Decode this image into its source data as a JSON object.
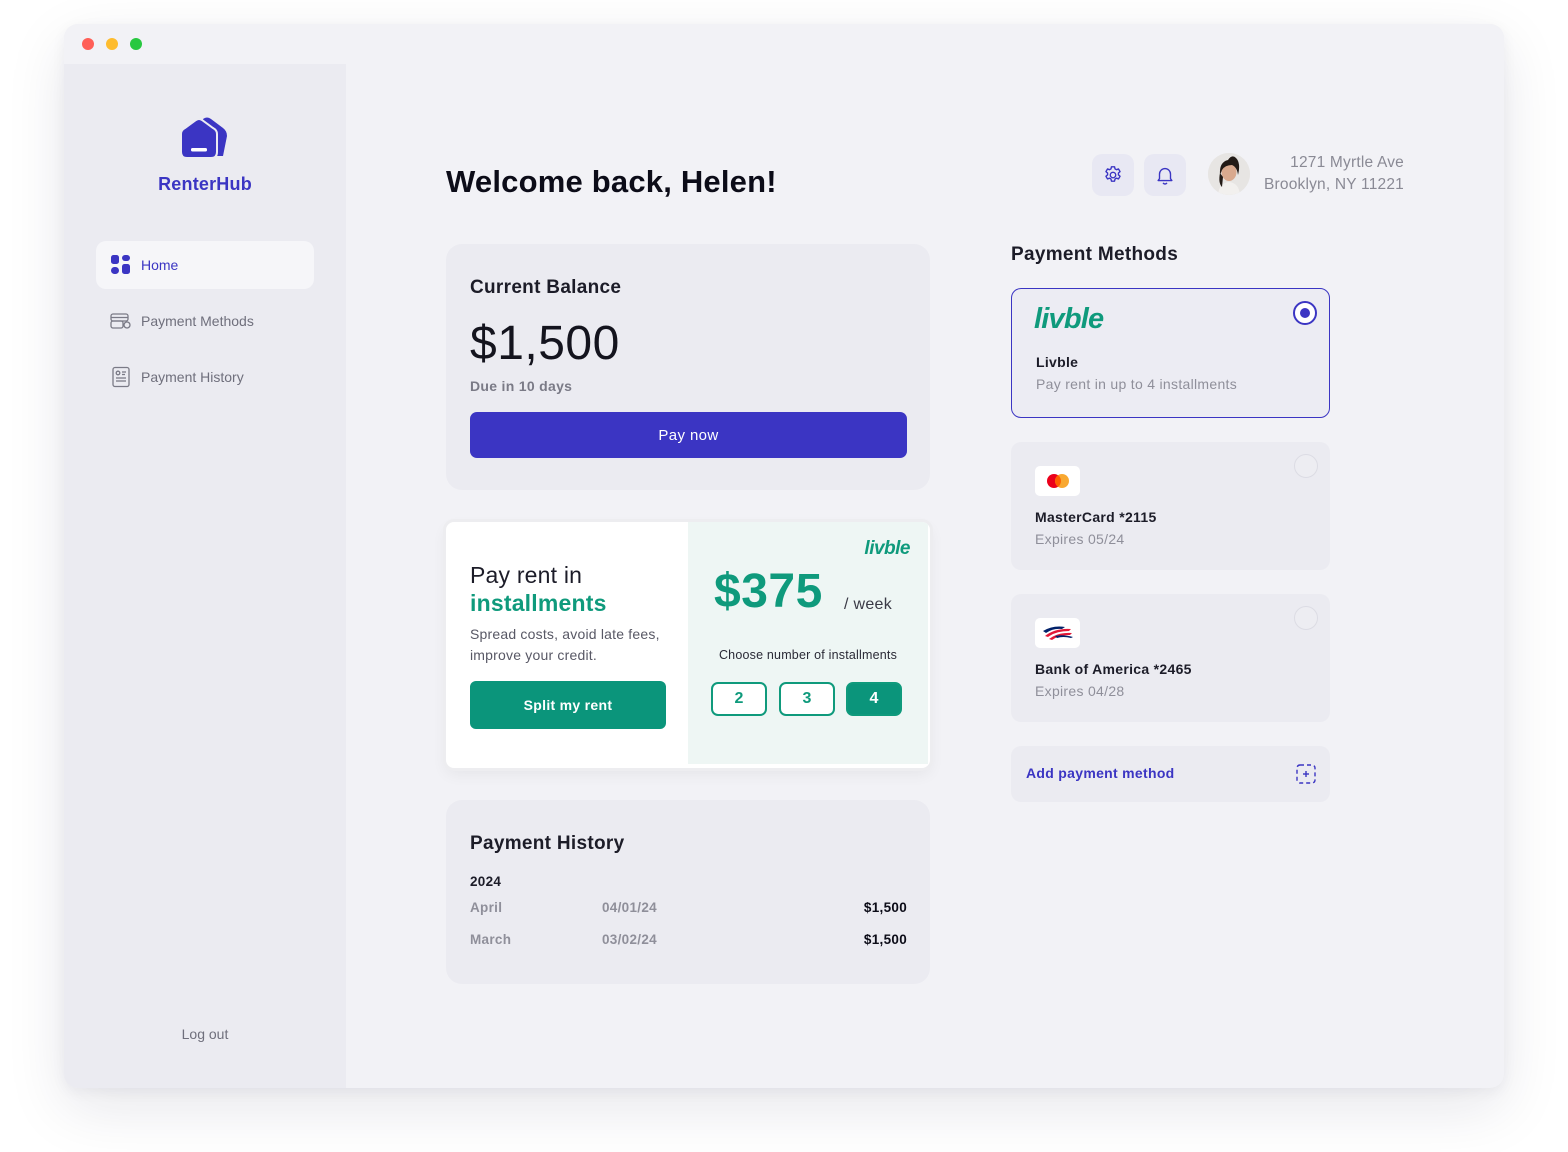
{
  "app": {
    "brand": "RenterHub"
  },
  "sidebar": {
    "items": [
      {
        "label": "Home",
        "icon": "dashboard-icon",
        "active": true
      },
      {
        "label": "Payment Methods",
        "icon": "wallet-card-icon",
        "active": false
      },
      {
        "label": "Payment History",
        "icon": "receipt-icon",
        "active": false
      }
    ],
    "logout": "Log out"
  },
  "header": {
    "greeting": "Welcome back, Helen!",
    "address_line1": "1271 Myrtle Ave",
    "address_line2": "Brooklyn, NY 11221",
    "icons": [
      "gear-icon",
      "bell-icon"
    ]
  },
  "balance": {
    "title": "Current Balance",
    "amount": "$1,500",
    "due": "Due in 10 days",
    "pay_label": "Pay now"
  },
  "installments": {
    "title_line1": "Pay rent in",
    "title_line2": "installments",
    "description": "Spread costs, avoid late fees, improve your credit.",
    "cta": "Split my rent",
    "provider_logo": "livble",
    "weekly_amount": "$375",
    "weekly_unit": "/ week",
    "choose_label": "Choose number of installments",
    "options": [
      "2",
      "3",
      "4"
    ],
    "selected_option": "4"
  },
  "history": {
    "title": "Payment History",
    "year": "2024",
    "rows": [
      {
        "month": "April",
        "date": "04/01/24",
        "amount": "$1,500"
      },
      {
        "month": "March",
        "date": "03/02/24",
        "amount": "$1,500"
      }
    ]
  },
  "payment_methods": {
    "heading": "Payment Methods",
    "items": [
      {
        "logo": "livble",
        "name": "Livble",
        "sub": "Pay rent in up to 4 installments",
        "selected": true
      },
      {
        "logo": "mastercard-icon",
        "name": "MasterCard *2115",
        "sub": "Expires 05/24",
        "selected": false
      },
      {
        "logo": "bank-of-america-icon",
        "name": "Bank of America *2465",
        "sub": "Expires 04/28",
        "selected": false
      }
    ],
    "add_label": "Add payment method"
  },
  "colors": {
    "accent": "#3b35c3",
    "green": "#0b957b",
    "background": "#f2f2f6",
    "sidebar": "#ebebf1"
  }
}
